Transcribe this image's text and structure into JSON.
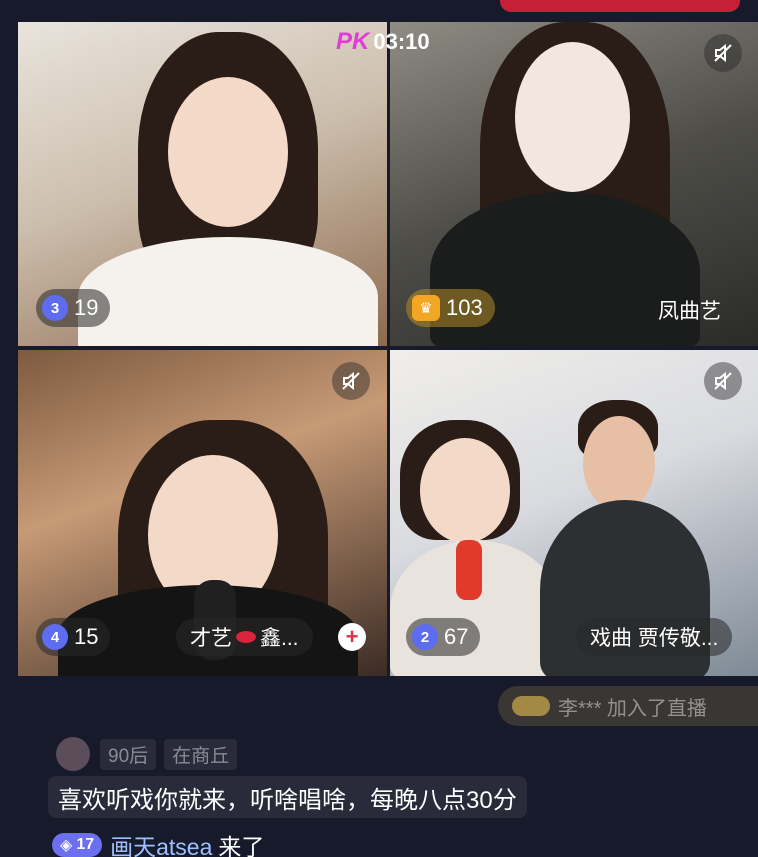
{
  "top_bar": {
    "fragment_left": "",
    "fragment_right": ""
  },
  "pk": {
    "label": "PK",
    "timer": "03:10"
  },
  "tiles": [
    {
      "rank": "3",
      "count": "19"
    },
    {
      "count": "103",
      "name": "凤曲艺"
    },
    {
      "rank": "4",
      "count": "15",
      "name": "才艺",
      "name_suffix": "鑫...",
      "add": "+"
    },
    {
      "rank": "2",
      "count": "67",
      "name": "戏曲 贾传敬..."
    }
  ],
  "join_banner": {
    "text": "李*** 加入了直播"
  },
  "chat": {
    "meta_age": "90后",
    "meta_location": "在商丘",
    "message": "喜欢听戏你就来，听啥唱啥，每晚八点30分",
    "join_level": "17",
    "join_user": "画天atsea",
    "join_action": "来了"
  },
  "colors": {
    "background": "#171a2b",
    "rank_badge": "#5d6cf0",
    "crown": "#f2a623",
    "pk": "#e03cd8"
  }
}
